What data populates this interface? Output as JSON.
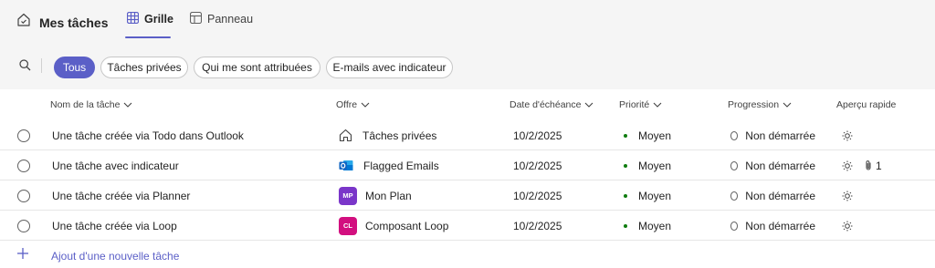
{
  "header": {
    "title": "Mes tâches",
    "tabs": [
      {
        "label": "Grille",
        "active": true
      },
      {
        "label": "Panneau",
        "active": false
      }
    ]
  },
  "filters": [
    {
      "label": "Tous",
      "active": true
    },
    {
      "label": "Tâches privées",
      "active": false
    },
    {
      "label": "Qui me sont attribuées",
      "active": false
    },
    {
      "label": "E-mails avec indicateur",
      "active": false
    }
  ],
  "columns": {
    "name": "Nom de la tâche",
    "plan": "Offre",
    "due": "Date d'échéance",
    "priority": "Priorité",
    "progress": "Progression",
    "quick": "Aperçu rapide"
  },
  "rows": [
    {
      "name": "Une tâche créée via Todo dans Outlook",
      "plan": "Tâches privées",
      "plan_icon": "home-icon",
      "due": "10/2/2025",
      "priority": "Moyen",
      "progress": "Non démarrée",
      "attachments": ""
    },
    {
      "name": "Une tâche avec indicateur",
      "plan": "Flagged Emails",
      "plan_icon": "outlook-icon",
      "due": "10/2/2025",
      "priority": "Moyen",
      "progress": "Non démarrée",
      "attachments": "1"
    },
    {
      "name": "Une tâche créée via Planner",
      "plan": "Mon Plan",
      "plan_icon": "badge",
      "plan_badge": "MP",
      "plan_color": "#7a36c9",
      "due": "10/2/2025",
      "priority": "Moyen",
      "progress": "Non démarrée",
      "attachments": ""
    },
    {
      "name": "Une tâche créée via Loop",
      "plan": "Composant Loop",
      "plan_icon": "badge",
      "plan_badge": "CL",
      "plan_color": "#d20f7f",
      "due": "10/2/2025",
      "priority": "Moyen",
      "progress": "Non démarrée",
      "attachments": ""
    }
  ],
  "add_task_label": "Ajout d'une nouvelle tâche",
  "colors": {
    "accent": "#5b5fc7",
    "priority_dot": "#107c10"
  }
}
